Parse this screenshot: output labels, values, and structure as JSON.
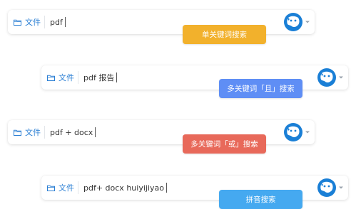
{
  "rows": [
    {
      "scope_label": "文件",
      "query": "pdf",
      "tag_label": "单关键词搜索",
      "tag_color": "#f2b12c",
      "scope_icon": "folder-icon",
      "avatar_icon": "user-avatar",
      "menu_icon": "chevron-down-icon"
    },
    {
      "scope_label": "文件",
      "query": "pdf 报告",
      "tag_label": "多关键词「且」搜索",
      "tag_color": "#5f8ef5",
      "scope_icon": "folder-icon",
      "avatar_icon": "user-avatar",
      "menu_icon": "chevron-down-icon"
    },
    {
      "scope_label": "文件",
      "query": "pdf + docx",
      "tag_label": "多关键词「或」搜索",
      "tag_color": "#e8695a",
      "scope_icon": "folder-icon",
      "avatar_icon": "user-avatar",
      "menu_icon": "chevron-down-icon"
    },
    {
      "scope_label": "文件",
      "query": "pdf+ docx huiyijiyao",
      "tag_label": "拼音搜索",
      "tag_color": "#45a9f0",
      "scope_icon": "folder-icon",
      "avatar_icon": "user-avatar",
      "menu_icon": "chevron-down-icon"
    }
  ],
  "colors": {
    "accent": "#2b7fd4",
    "avatar": "#1a7fd6"
  }
}
